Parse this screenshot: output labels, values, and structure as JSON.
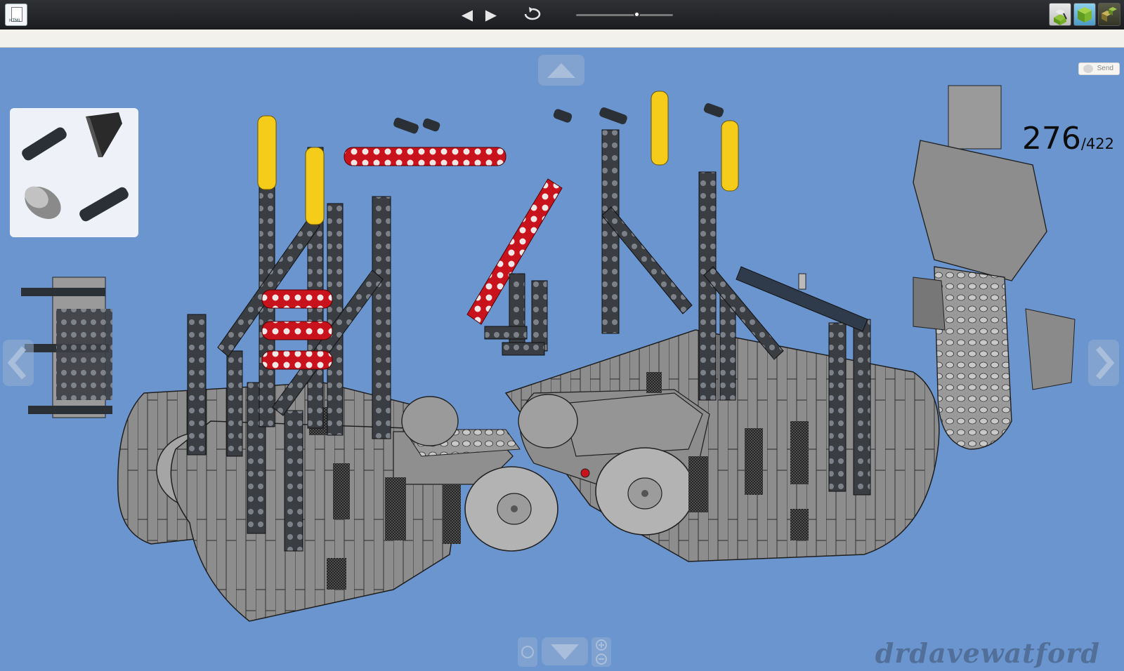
{
  "toolbar": {
    "file_icon_tag": "HTML",
    "prev_icon": "triangle-left-icon",
    "next_icon": "triangle-right-icon",
    "rotate_icon": "rotate-icon",
    "step_slider_fraction": 0.62,
    "mode_buttons": [
      "building-mode-icon",
      "model-view-icon",
      "sub-model-icon"
    ]
  },
  "subbar": {
    "send_label": "Send"
  },
  "step": {
    "current": "276",
    "total": "/422"
  },
  "parts_panel": {
    "items": [
      "axle-pin-icon",
      "slope-brick-icon",
      "round-brick-icon",
      "axle-pin-long-icon"
    ]
  },
  "navigation": {
    "up": "triangle-up-icon",
    "down": "triangle-down-icon",
    "left": "chevron-left-icon",
    "right": "chevron-right-icon",
    "rotate_view": "rotate-view-icon",
    "zoom": "zoom-plus-minus-icon"
  },
  "watermark": "drdavewatford",
  "colors": {
    "background": "#6b95cf",
    "model_gray": "#8d8d8d",
    "technic_dark": "#3b3f45",
    "technic_red": "#c8121c",
    "technic_yellow": "#f5cc19"
  }
}
